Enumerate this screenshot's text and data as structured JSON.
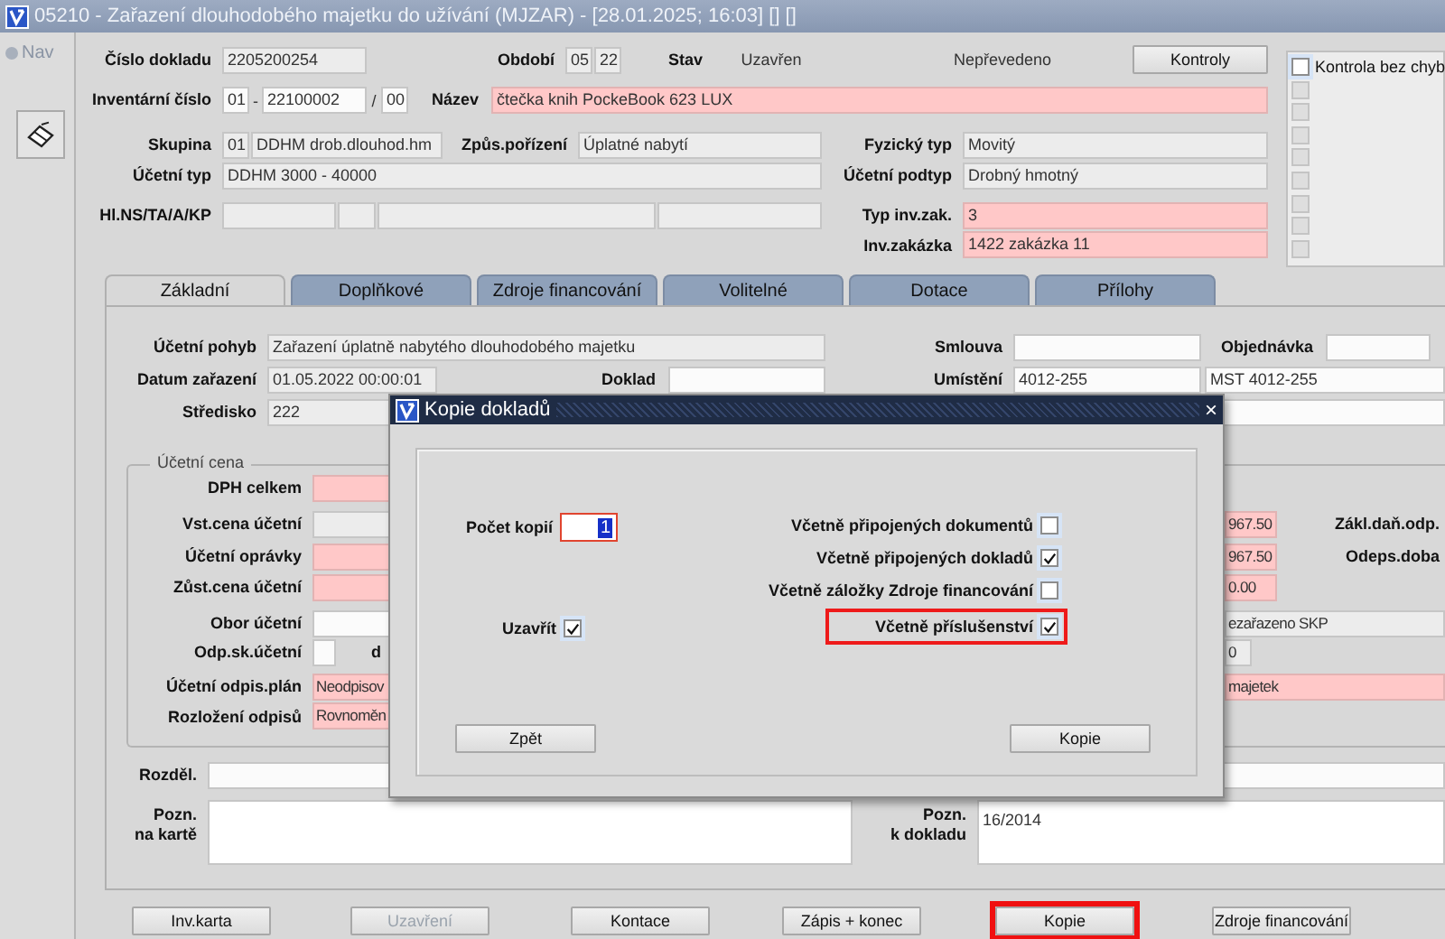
{
  "window": {
    "title": "05210 - Zařazení dlouhodobého majetku do užívání (MJZAR) - [28.01.2025; 16:03] [] []"
  },
  "nav": {
    "label": "Nav"
  },
  "header_rows": [
    [
      {
        "kind": "label",
        "text": "Číslo dokladu"
      },
      {
        "kind": "readonly",
        "value": "2205200254"
      },
      {
        "kind": "label",
        "text": "Období"
      },
      {
        "kind": "readonly",
        "value": "05"
      },
      {
        "kind": "readonly",
        "value": "22"
      },
      {
        "kind": "label",
        "text": "Stav"
      },
      {
        "kind": "text",
        "text": "Uzavřen"
      },
      {
        "kind": "text",
        "text": "Nepřevedeno"
      },
      {
        "kind": "button",
        "text": "Kontroly"
      }
    ],
    [
      {
        "kind": "label",
        "text": "Inventární číslo"
      },
      {
        "kind": "input",
        "value": "01"
      },
      {
        "kind": "text",
        "text": "-"
      },
      {
        "kind": "input",
        "value": "22100002"
      },
      {
        "kind": "text",
        "text": "/"
      },
      {
        "kind": "input",
        "value": "00"
      },
      {
        "kind": "label",
        "text": "Název"
      },
      {
        "kind": "required",
        "value": "čtečka knih PockeBook 623 LUX"
      }
    ],
    [
      {
        "kind": "label",
        "text": "Skupina"
      },
      {
        "kind": "readonly",
        "value": "01"
      },
      {
        "kind": "readonly",
        "value": "DDHM drob.dlouhod.hm"
      },
      {
        "kind": "label",
        "text": "Způs.pořízení"
      },
      {
        "kind": "readonly",
        "value": "Úplatné nabytí"
      },
      {
        "kind": "label",
        "text": "Fyzický typ"
      },
      {
        "kind": "readonly",
        "value": "Movitý"
      }
    ],
    [
      {
        "kind": "label",
        "text": "Účetní typ"
      },
      {
        "kind": "readonly",
        "value": "DDHM 3000 - 40000"
      },
      {
        "kind": "label",
        "text": "Účetní podtyp"
      },
      {
        "kind": "readonly",
        "value": "Drobný hmotný"
      }
    ],
    [
      {
        "kind": "label",
        "text": "Hl.NS/TA/A/KP"
      },
      {
        "kind": "readonly"
      },
      {
        "kind": "readonly"
      },
      {
        "kind": "readonly"
      },
      {
        "kind": "readonly"
      },
      {
        "kind": "label",
        "text": "Typ inv.zak."
      },
      {
        "kind": "required",
        "value": "3"
      }
    ],
    [
      {
        "kind": "label",
        "text": "Inv.zakázka"
      },
      {
        "kind": "required",
        "value": "1422 zakázka 11"
      }
    ]
  ],
  "check_list": [
    {
      "label": "Kontrola bez chyb",
      "checked": false,
      "disabled": false
    },
    {
      "checked": false,
      "disabled": true
    },
    {
      "checked": false,
      "disabled": true
    },
    {
      "checked": false,
      "disabled": true
    },
    {
      "checked": false,
      "disabled": true
    },
    {
      "checked": false,
      "disabled": true
    },
    {
      "checked": false,
      "disabled": true
    },
    {
      "checked": false,
      "disabled": true
    },
    {
      "checked": false,
      "disabled": true
    }
  ],
  "tabs": [
    {
      "label": "Základní",
      "selected": true
    },
    {
      "label": "Doplňkové",
      "selected": false
    },
    {
      "label": "Zdroje financování",
      "selected": false
    },
    {
      "label": "Volitelné",
      "selected": false
    },
    {
      "label": "Dotace",
      "selected": false
    },
    {
      "label": "Přílohy",
      "selected": false
    }
  ],
  "tab_rows": [
    [
      {
        "kind": "label",
        "text": "Účetní pohyb"
      },
      {
        "kind": "readonly",
        "value": "Zařazení úplatně nabytého dlouhodobého majetku"
      },
      {
        "kind": "label",
        "text": "Smlouva"
      },
      {
        "kind": "input"
      },
      {
        "kind": "label",
        "text": "Objednávka"
      },
      {
        "kind": "input"
      }
    ],
    [
      {
        "kind": "label",
        "text": "Datum zařazení"
      },
      {
        "kind": "readonly",
        "value": "01.05.2022 00:00:01"
      },
      {
        "kind": "label",
        "text": "Doklad"
      },
      {
        "kind": "input"
      },
      {
        "kind": "label",
        "text": "Umístění"
      },
      {
        "kind": "input",
        "value": "4012-255"
      },
      {
        "kind": "input",
        "value": "MST 4012-255"
      }
    ],
    [
      {
        "kind": "label",
        "text": "Středisko"
      },
      {
        "kind": "readonly",
        "value": "222"
      },
      {
        "kind": "input"
      }
    ]
  ],
  "price_group": {
    "title": "Účetní cena",
    "cut_label": "d",
    "rows": [
      [
        {
          "kind": "label",
          "text": "DPH celkem"
        },
        {
          "kind": "required"
        }
      ],
      [
        {
          "kind": "label",
          "text": "Vst.cena účetní"
        },
        {
          "kind": "readonly"
        },
        {
          "kind": "required",
          "value": "967.50"
        },
        {
          "kind": "label",
          "text": "Zákl.daň.odp."
        }
      ],
      [
        {
          "kind": "label",
          "text": "Účetní oprávky"
        },
        {
          "kind": "required"
        },
        {
          "kind": "required",
          "value": "967.50"
        },
        {
          "kind": "label",
          "text": "Odeps.doba"
        }
      ],
      [
        {
          "kind": "label",
          "text": "Zůst.cena účetní"
        },
        {
          "kind": "required"
        },
        {
          "kind": "required",
          "value": "0.00"
        }
      ],
      [
        {
          "kind": "label",
          "text": "Obor účetní"
        },
        {
          "kind": "input"
        },
        {
          "kind": "readonly",
          "value": "ezařazeno SKP"
        }
      ],
      [
        {
          "kind": "label",
          "text": "Odp.sk.účetní"
        },
        {
          "kind": "input"
        },
        {
          "kind": "readonly",
          "value": "0"
        }
      ],
      [
        {
          "kind": "label",
          "text": "Účetní odpis.plán"
        },
        {
          "kind": "required",
          "value": "Neodpisov"
        },
        {
          "kind": "required",
          "value": "majetek"
        }
      ],
      [
        {
          "kind": "label",
          "text": "Rozložení odpisů"
        },
        {
          "kind": "required",
          "value": "Rovnoměn"
        }
      ]
    ]
  },
  "note_rows": [
    [
      {
        "kind": "label",
        "text": "Rozděl."
      },
      {
        "kind": "input"
      }
    ],
    [
      {
        "kind": "label",
        "text": "Pozn.\nna kartě"
      },
      {
        "kind": "area"
      },
      {
        "kind": "label",
        "text": "Pozn.\nk dokladu"
      },
      {
        "kind": "area",
        "value": "16/2014"
      }
    ]
  ],
  "buttons": [
    {
      "label": "Inv.karta",
      "disabled": false,
      "highlighted": false
    },
    {
      "label": "Uzavření",
      "disabled": true,
      "highlighted": false
    },
    {
      "label": "Kontace",
      "disabled": false,
      "highlighted": false
    },
    {
      "label": "Zápis + konec",
      "disabled": false,
      "highlighted": false
    },
    {
      "label": "Kopie",
      "disabled": false,
      "highlighted": true
    },
    {
      "label": "Zdroje financování",
      "disabled": false,
      "highlighted": false
    }
  ],
  "dialog": {
    "title": "Kopie dokladů",
    "close": "×",
    "copies": {
      "label": "Počet kopií",
      "value": "1",
      "focused": true,
      "text_selected": true
    },
    "close_after": {
      "label": "Uzavřít",
      "checked": true
    },
    "options": [
      {
        "label": "Včetně připojených dokumentů",
        "checked": false,
        "highlighted": false
      },
      {
        "label": "Včetně připojených dokladů",
        "checked": true,
        "highlighted": false
      },
      {
        "label": "Včetně záložky Zdroje financování",
        "checked": false,
        "highlighted": false
      },
      {
        "label": "Včetně příslušenství",
        "checked": true,
        "highlighted": true
      }
    ],
    "buttons": [
      {
        "label": "Zpět"
      },
      {
        "label": "Kopie"
      }
    ]
  }
}
